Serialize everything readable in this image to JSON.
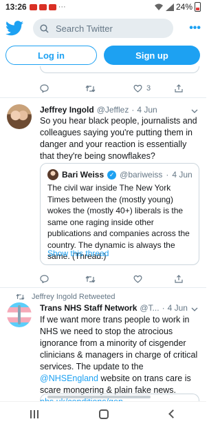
{
  "status_bar": {
    "time": "13:26",
    "battery": "24%"
  },
  "header": {
    "logo_icon": "twitter-bird-icon",
    "search_placeholder": "Search Twitter",
    "more_label": "•••"
  },
  "auth": {
    "login_label": "Log in",
    "signup_label": "Sign up"
  },
  "prev_tweet_actions": {
    "likes": "3"
  },
  "tweets": [
    {
      "name": "Jeffrey Ingold",
      "handle": "@Jefflez",
      "time": "4 Jun",
      "text": "So you hear black people, journalists and colleagues saying you're putting them in danger and your reaction is essentially that they're being snowflakes?",
      "quote": {
        "name": "Bari Weiss",
        "handle": "@bariweiss",
        "time": "4 Jun",
        "text": "The civil war inside The New York Times between the (mostly young) wokes the (mostly 40+) liberals is the same one raging inside other publications and companies across the country. The dynamic is always the same. (Thread.)",
        "show_thread": "Show this thread"
      }
    },
    {
      "retweeted_by": "Jeffrey Ingold Retweeted",
      "name": "Trans NHS Staff Network",
      "handle": "@T...",
      "time": "4 Jun",
      "text_before": "If we want more trans people to work in NHS we need to stop the atrocious ignorance from a minority of cisgender clinicians & managers in charge of critical services. The update to the ",
      "mention": "@NHSEngland",
      "text_middle": " website on trans care is scare mongering & plain fake news. ",
      "url": "nhs.uk/conditions/gen..."
    }
  ],
  "colors": {
    "accent": "#1da1f2",
    "text": "#14171a",
    "muted": "#657786",
    "border": "#ccd6dd"
  }
}
